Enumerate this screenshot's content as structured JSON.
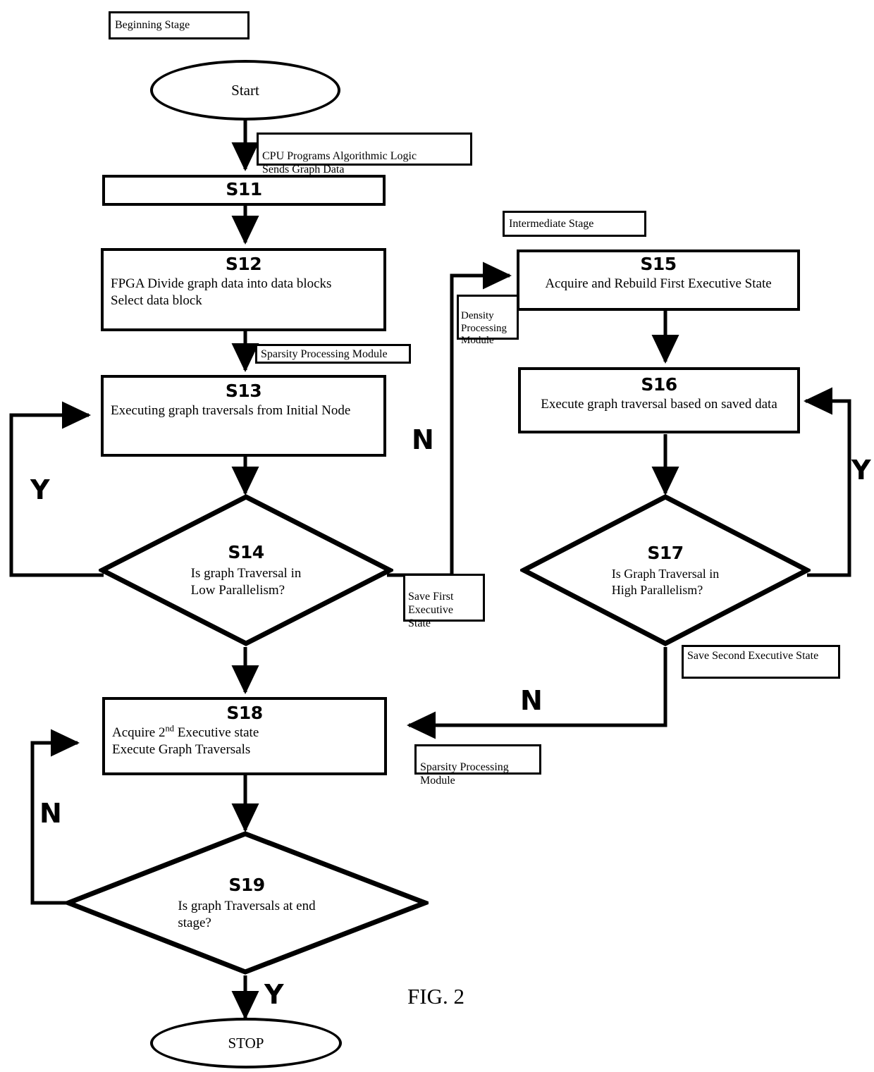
{
  "figure": {
    "caption": "FIG. 2"
  },
  "stage_labels": {
    "beginning": "Beginning Stage",
    "intermediate": "Intermediate Stage"
  },
  "terminators": {
    "start": "Start",
    "stop": "STOP"
  },
  "annotations": {
    "cpu_programs": "CPU Programs Algorithmic Logic\nSends Graph Data",
    "sparsity_top": "Sparsity Processing Module",
    "density_module": "Density\nProcessing\nModule",
    "save_first": "Save First\nExecutive\nState",
    "save_second": "Save Second Executive State",
    "sparsity_bottom": "Sparsity Processing\nModule"
  },
  "steps": {
    "s11": {
      "id": "S11",
      "body": ""
    },
    "s12": {
      "id": "S12",
      "body": "FPGA Divide graph data into data blocks\nSelect data block"
    },
    "s13": {
      "id": "S13",
      "body": "Executing graph traversals from Initial Node"
    },
    "s14": {
      "id": "S14",
      "body": "Is graph Traversal in\nLow Parallelism?"
    },
    "s15": {
      "id": "S15",
      "body": "Acquire and Rebuild First Executive State"
    },
    "s16": {
      "id": "S16",
      "body": "Execute graph traversal based on saved data"
    },
    "s17": {
      "id": "S17",
      "body": "Is Graph Traversal in\nHigh Parallelism?"
    },
    "s18": {
      "id": "S18",
      "body_line1_pre": "Acquire 2",
      "body_line1_sup": "nd",
      "body_line1_post": " Executive state",
      "body_line2": "Execute Graph Traversals"
    },
    "s19": {
      "id": "S19",
      "body": "Is graph Traversals at end\nstage?"
    }
  },
  "branch_labels": {
    "s14_yes": "Y",
    "s14_no": "N",
    "s17_yes": "Y",
    "s17_no": "N",
    "s19_yes": "Y",
    "s19_no": "N"
  },
  "colors": {
    "stroke": "#000000",
    "fill": "#ffffff"
  }
}
